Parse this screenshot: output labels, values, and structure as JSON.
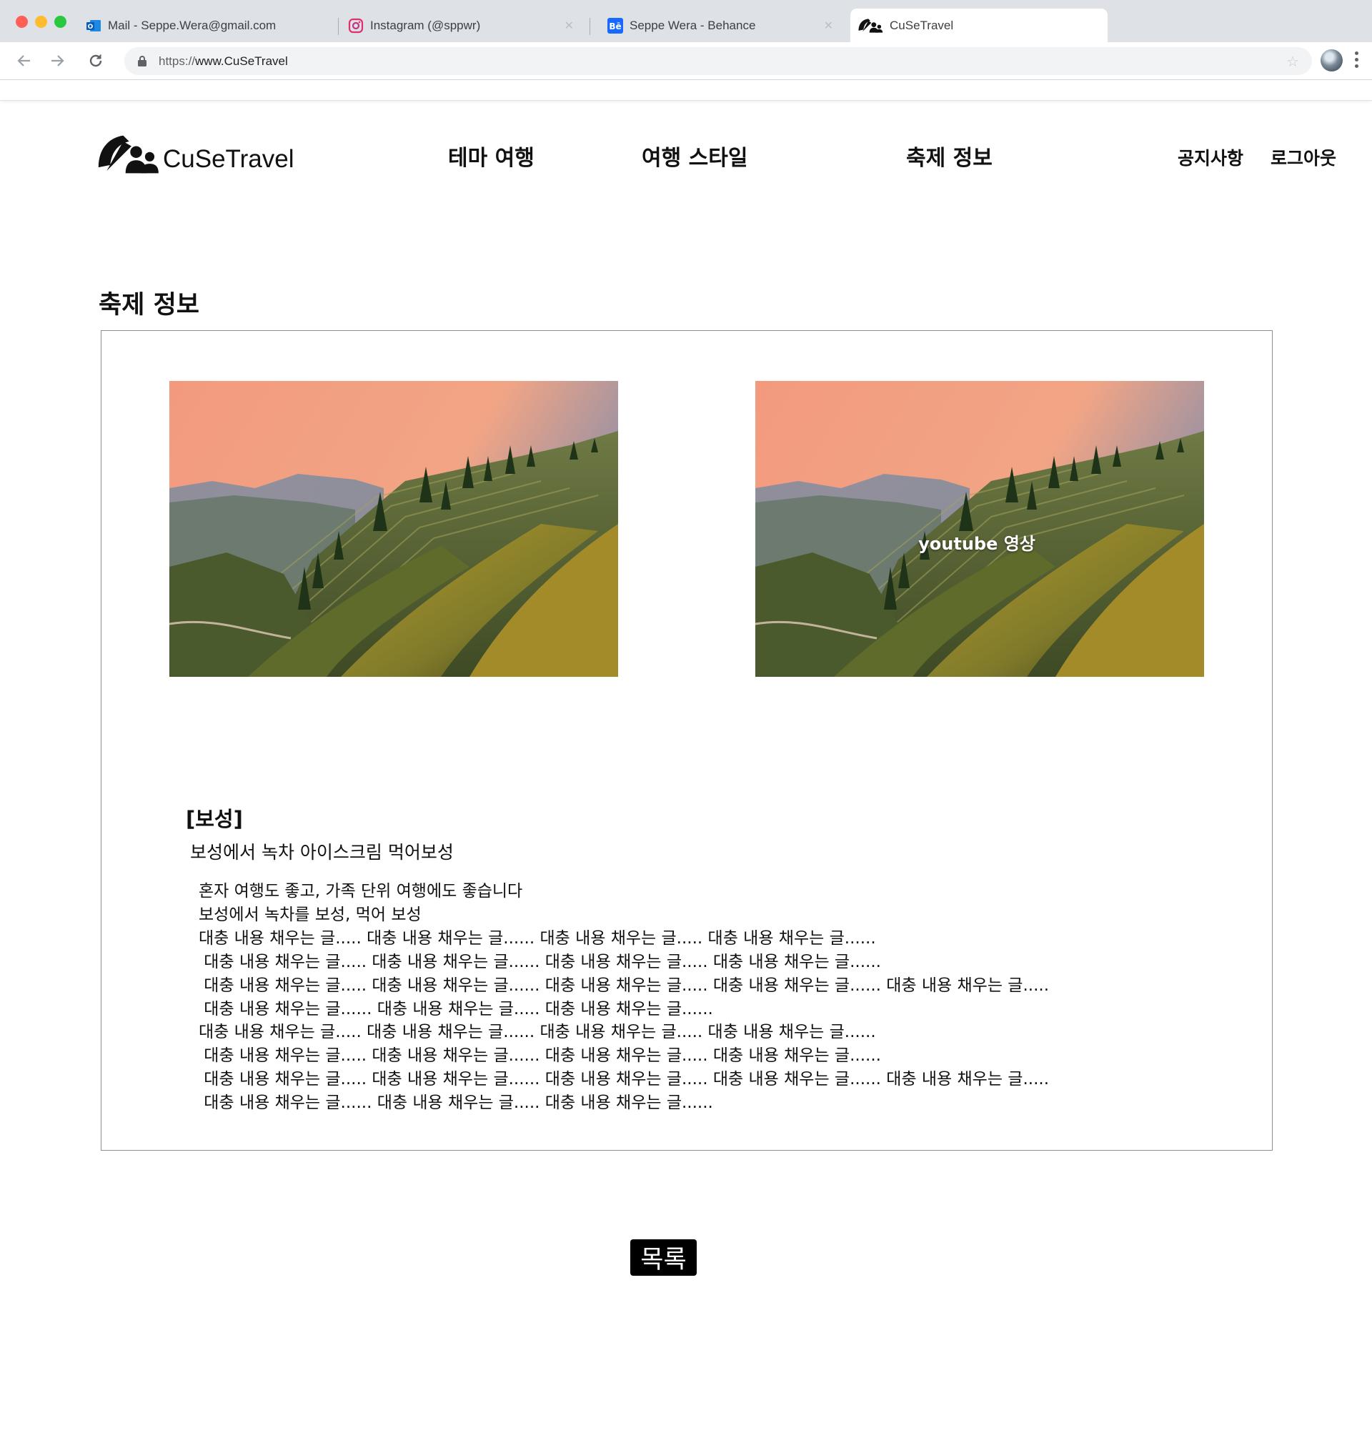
{
  "browser": {
    "tabs": [
      {
        "title": "Mail - Seppe.Wera@gmail.com",
        "icon": "outlook-icon"
      },
      {
        "title": "Instagram (@sppwr)",
        "icon": "instagram-icon"
      },
      {
        "title": "Seppe Wera - Behance",
        "icon": "behance-icon"
      },
      {
        "title": "CuSeTravel",
        "icon": "cusetravel-icon",
        "active": true
      }
    ],
    "url_scheme": "https://",
    "url_host": "www.CuSeTravel"
  },
  "site": {
    "logo_text": "CuSeTravel",
    "nav": [
      "테마 여행",
      "여행 스타일",
      "축제 정보"
    ],
    "util": [
      "공지사항",
      "로그아웃"
    ]
  },
  "page": {
    "title": "축제 정보",
    "video_caption": "youtube 영상",
    "heading": "[보성]",
    "subtitle": "보성에서 녹차 아이스크림 먹어보성",
    "body_lines": [
      "혼자 여행도 좋고, 가족 단위 여행에도 좋습니다",
      "보성에서 녹차를 보성, 먹어 보성",
      "대충 내용 채우는 글..... 대충 내용 채우는 글...... 대충 내용 채우는 글..... 대충 내용 채우는 글......",
      " 대충 내용 채우는 글..... 대충 내용 채우는 글...... 대충 내용 채우는 글..... 대충 내용 채우는 글......",
      " 대충 내용 채우는 글..... 대충 내용 채우는 글...... 대충 내용 채우는 글..... 대충 내용 채우는 글...... 대충 내용 채우는 글.....",
      " 대충 내용 채우는 글...... 대충 내용 채우는 글..... 대충 내용 채우는 글......",
      "대충 내용 채우는 글..... 대충 내용 채우는 글...... 대충 내용 채우는 글..... 대충 내용 채우는 글......",
      " 대충 내용 채우는 글..... 대충 내용 채우는 글...... 대충 내용 채우는 글..... 대충 내용 채우는 글......",
      " 대충 내용 채우는 글..... 대충 내용 채우는 글...... 대충 내용 채우는 글..... 대충 내용 채우는 글...... 대충 내용 채우는 글.....",
      " 대충 내용 채우는 글...... 대충 내용 채우는 글..... 대충 내용 채우는 글......"
    ],
    "list_button": "목록"
  },
  "colors": {
    "tabbar_bg": "#dee1e6",
    "button_bg": "#000000",
    "panel_border": "#8e8e8e"
  }
}
